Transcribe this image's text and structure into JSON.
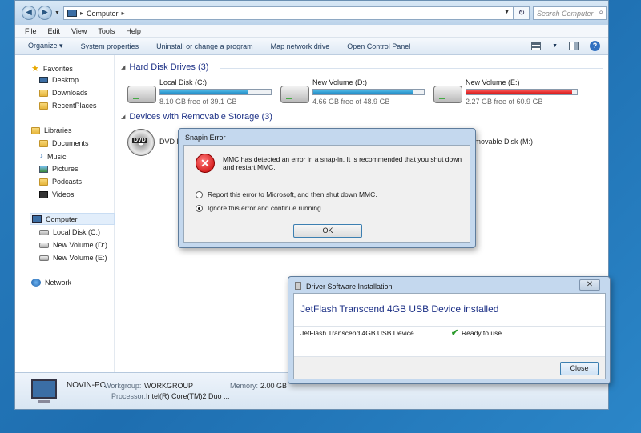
{
  "address": {
    "crumb": "Computer"
  },
  "search": {
    "placeholder": "Search Computer"
  },
  "menu": [
    "File",
    "Edit",
    "View",
    "Tools",
    "Help"
  ],
  "commands": [
    "Organize",
    "System properties",
    "Uninstall or change a program",
    "Map network drive",
    "Open Control Panel"
  ],
  "sidebar": {
    "favorites": "Favorites",
    "favorite_items": [
      "Desktop",
      "Downloads",
      "RecentPlaces"
    ],
    "libraries": "Libraries",
    "library_items": [
      "Documents",
      "Music",
      "Pictures",
      "Podcasts",
      "Videos"
    ],
    "computer": "Computer",
    "computer_items": [
      "Local Disk (C:)",
      "New Volume (D:)",
      "New Volume (E:)"
    ],
    "network": "Network"
  },
  "groups": {
    "hard_disks": "Hard Disk Drives (3)",
    "removable": "Devices with Removable Storage (3)"
  },
  "drives": [
    {
      "name": "Local Disk (C:)",
      "free": "8.10 GB free of 39.1 GB",
      "used_fraction": 0.79,
      "critical": false
    },
    {
      "name": "New Volume (D:)",
      "free": "4.66 GB free of 48.9 GB",
      "used_fraction": 0.9,
      "critical": false
    },
    {
      "name": "New Volume (E:)",
      "free": "2.27 GB free of 60.9 GB",
      "used_fraction": 0.96,
      "critical": true
    }
  ],
  "removable": {
    "dvd_label": "DVD",
    "dvd_name": "DVD R",
    "removable_name": "Removable Disk (M:)"
  },
  "details": {
    "pc_name": "NOVIN-PC",
    "workgroup_label": "Workgroup:",
    "workgroup": "WORKGROUP",
    "memory_label": "Memory:",
    "memory": "2.00 GB",
    "processor_label": "Processor:",
    "processor": "Intel(R) Core(TM)2 Duo ..."
  },
  "snapin": {
    "title": "Snapin Error",
    "message": "MMC has detected an error in a snap-in. It is recommended that you shut down and restart MMC.",
    "option1": "Report this error to Microsoft, and then shut down MMC.",
    "option2": "Ignore this error and continue running",
    "ok": "OK"
  },
  "driver": {
    "title": "Driver Software Installation",
    "heading": "JetFlash Transcend 4GB USB Device installed",
    "device": "JetFlash Transcend 4GB USB Device",
    "status": "Ready to use",
    "close": "Close"
  }
}
